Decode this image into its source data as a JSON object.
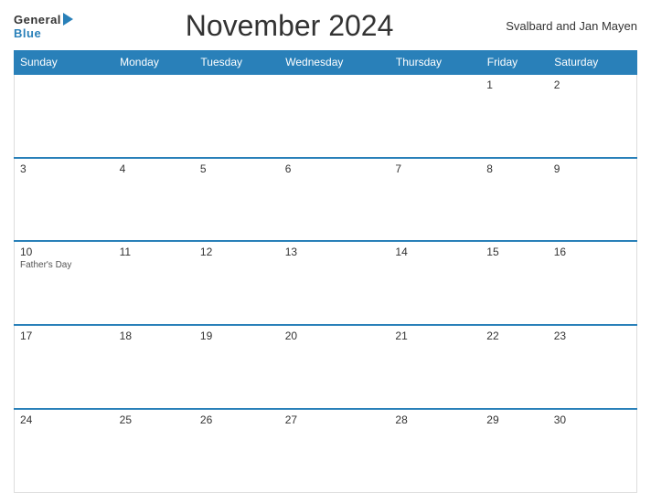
{
  "header": {
    "logo_general": "General",
    "logo_blue": "Blue",
    "title": "November 2024",
    "region": "Svalbard and Jan Mayen"
  },
  "calendar": {
    "days_of_week": [
      "Sunday",
      "Monday",
      "Tuesday",
      "Wednesday",
      "Thursday",
      "Friday",
      "Saturday"
    ],
    "weeks": [
      [
        {
          "date": "",
          "holiday": ""
        },
        {
          "date": "",
          "holiday": ""
        },
        {
          "date": "",
          "holiday": ""
        },
        {
          "date": "",
          "holiday": ""
        },
        {
          "date": "",
          "holiday": ""
        },
        {
          "date": "1",
          "holiday": ""
        },
        {
          "date": "2",
          "holiday": ""
        }
      ],
      [
        {
          "date": "3",
          "holiday": ""
        },
        {
          "date": "4",
          "holiday": ""
        },
        {
          "date": "5",
          "holiday": ""
        },
        {
          "date": "6",
          "holiday": ""
        },
        {
          "date": "7",
          "holiday": ""
        },
        {
          "date": "8",
          "holiday": ""
        },
        {
          "date": "9",
          "holiday": ""
        }
      ],
      [
        {
          "date": "10",
          "holiday": "Father's Day"
        },
        {
          "date": "11",
          "holiday": ""
        },
        {
          "date": "12",
          "holiday": ""
        },
        {
          "date": "13",
          "holiday": ""
        },
        {
          "date": "14",
          "holiday": ""
        },
        {
          "date": "15",
          "holiday": ""
        },
        {
          "date": "16",
          "holiday": ""
        }
      ],
      [
        {
          "date": "17",
          "holiday": ""
        },
        {
          "date": "18",
          "holiday": ""
        },
        {
          "date": "19",
          "holiday": ""
        },
        {
          "date": "20",
          "holiday": ""
        },
        {
          "date": "21",
          "holiday": ""
        },
        {
          "date": "22",
          "holiday": ""
        },
        {
          "date": "23",
          "holiday": ""
        }
      ],
      [
        {
          "date": "24",
          "holiday": ""
        },
        {
          "date": "25",
          "holiday": ""
        },
        {
          "date": "26",
          "holiday": ""
        },
        {
          "date": "27",
          "holiday": ""
        },
        {
          "date": "28",
          "holiday": ""
        },
        {
          "date": "29",
          "holiday": ""
        },
        {
          "date": "30",
          "holiday": ""
        }
      ]
    ]
  }
}
